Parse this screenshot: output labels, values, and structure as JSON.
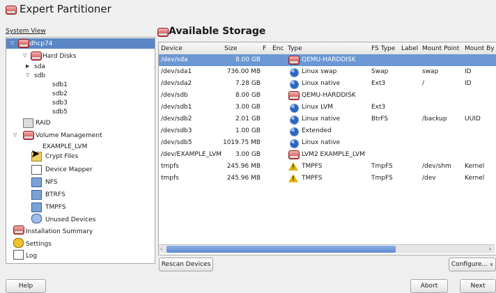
{
  "app": {
    "title": "Expert Partitioner"
  },
  "sidebar": {
    "label": "System View",
    "items": [
      {
        "label": "dhcp74"
      },
      {
        "label": "Hard Disks"
      },
      {
        "label": "sda"
      },
      {
        "label": "sdb"
      },
      {
        "label": "sdb1"
      },
      {
        "label": "sdb2"
      },
      {
        "label": "sdb3"
      },
      {
        "label": "sdb5"
      },
      {
        "label": "RAID"
      },
      {
        "label": "Volume Management"
      },
      {
        "label": "EXAMPLE_LVM"
      },
      {
        "label": "Crypt Files"
      },
      {
        "label": "Device Mapper"
      },
      {
        "label": "NFS"
      },
      {
        "label": "BTRFS"
      },
      {
        "label": "TMPFS"
      },
      {
        "label": "Unused Devices"
      },
      {
        "label": "Installation Summary"
      },
      {
        "label": "Settings"
      },
      {
        "label": "Log"
      }
    ]
  },
  "main": {
    "title": "Available Storage",
    "columns": [
      "Device",
      "Size",
      "F",
      "Enc",
      "Type",
      "FS Type",
      "Label",
      "Mount Point",
      "Mount By"
    ],
    "rows": [
      {
        "device": "/dev/sda",
        "size": "8.00 GB",
        "type": "QEMU-HARDDISK",
        "fs": "",
        "label": "",
        "mount": "",
        "by": "",
        "icon": "harddisk-icon"
      },
      {
        "device": "/dev/sda1",
        "size": "736.00 MB",
        "type": "Linux swap",
        "fs": "Swap",
        "label": "",
        "mount": "swap",
        "by": "ID",
        "icon": "partition-icon"
      },
      {
        "device": "/dev/sda2",
        "size": "7.28 GB",
        "type": "Linux native",
        "fs": "Ext3",
        "label": "",
        "mount": "/",
        "by": "ID",
        "icon": "partition-icon"
      },
      {
        "device": "/dev/sdb",
        "size": "8.00 GB",
        "type": "QEMU-HARDDISK",
        "fs": "",
        "label": "",
        "mount": "",
        "by": "",
        "icon": "harddisk-icon"
      },
      {
        "device": "/dev/sdb1",
        "size": "3.00 GB",
        "type": "Linux LVM",
        "fs": "Ext3",
        "label": "",
        "mount": "",
        "by": "",
        "icon": "partition-icon"
      },
      {
        "device": "/dev/sdb2",
        "size": "2.01 GB",
        "type": "Linux native",
        "fs": "BtrFS",
        "label": "",
        "mount": "/backup",
        "by": "UUID",
        "icon": "partition-icon"
      },
      {
        "device": "/dev/sdb3",
        "size": "1.00 GB",
        "type": "Extended",
        "fs": "",
        "label": "",
        "mount": "",
        "by": "",
        "icon": "partition-icon"
      },
      {
        "device": "/dev/sdb5",
        "size": "1019.75 MB",
        "type": "Linux native",
        "fs": "",
        "label": "",
        "mount": "",
        "by": "",
        "icon": "partition-icon"
      },
      {
        "device": "/dev/EXAMPLE_LVM",
        "size": "3.00 GB",
        "type": "LVM2 EXAMPLE_LVM",
        "fs": "",
        "label": "",
        "mount": "",
        "by": "",
        "icon": "harddisk-icon"
      },
      {
        "device": "tmpfs",
        "size": "245.96 MB",
        "type": "TMPFS",
        "fs": "TmpFS",
        "label": "",
        "mount": "/dev/shm",
        "by": "Kernel",
        "icon": "warning-icon"
      },
      {
        "device": "tmpfs",
        "size": "245.96 MB",
        "type": "TMPFS",
        "fs": "TmpFS",
        "label": "",
        "mount": "/dev",
        "by": "Kernel",
        "icon": "warning-icon"
      }
    ],
    "rescan_label": "Rescan Devices",
    "configure_label": "Configure..."
  },
  "footer": {
    "help": "Help",
    "abort": "Abort",
    "next": "Next"
  },
  "colors": {
    "selection": "#6b97d3",
    "tree_selection": "#5a86c5"
  }
}
